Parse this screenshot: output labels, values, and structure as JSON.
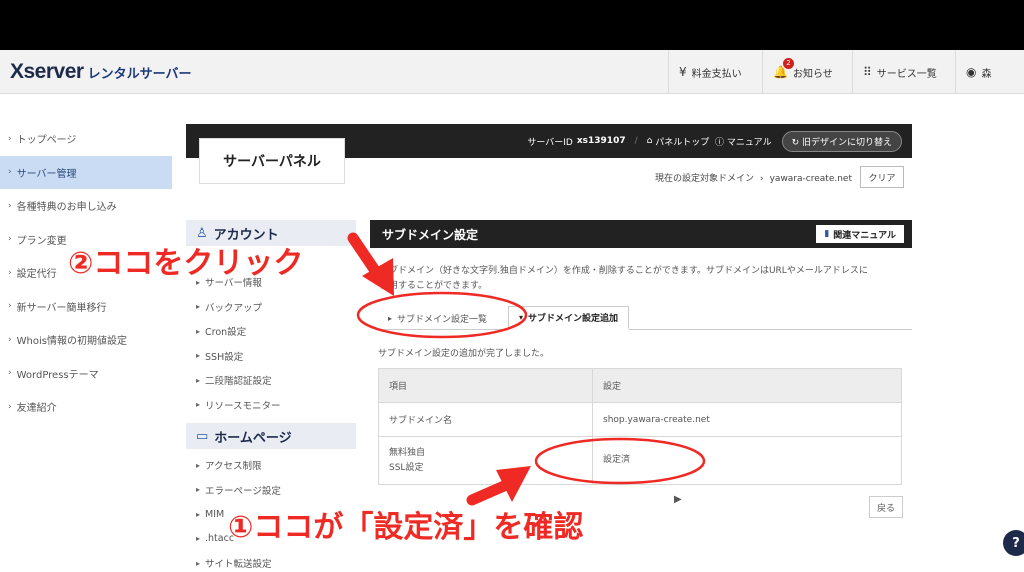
{
  "header": {
    "logo_main": "Xserver",
    "logo_sub": "レンタルサーバー",
    "nav": [
      {
        "icon": "yen-icon",
        "glyph": "¥",
        "label": "料金支払い"
      },
      {
        "icon": "bell-icon",
        "glyph": "🔔",
        "label": "お知らせ",
        "badge": "2"
      },
      {
        "icon": "grid-icon",
        "glyph": "⠿",
        "label": "サービス一覧"
      },
      {
        "icon": "user-icon",
        "glyph": "◉",
        "label": "森"
      }
    ]
  },
  "sidebar": {
    "items": [
      {
        "label": "トップページ"
      },
      {
        "label": "サーバー管理"
      },
      {
        "label": "各種特典のお申し込み"
      },
      {
        "label": "プラン変更"
      },
      {
        "label": "設定代行"
      },
      {
        "label": "新サーバー簡単移行"
      },
      {
        "label": "Whois情報の初期値設定"
      },
      {
        "label": "WordPressテーマ"
      },
      {
        "label": "友達紹介"
      }
    ]
  },
  "panel": {
    "title": "サーバーパネル",
    "server_id_label": "サーバーID",
    "server_id": "xs139107",
    "panel_top": "パネルトップ",
    "manual": "マニュアル",
    "old_design": "旧デザインに切り替え",
    "target_label": "現在の設定対象ドメイン",
    "target_domain": "yawara-create.net",
    "clear": "クリア"
  },
  "subnav": {
    "account": {
      "heading": "アカウント",
      "items": [
        "サーバー情報",
        "バックアップ",
        "Cron設定",
        "SSH設定",
        "二段階認証設定",
        "リソースモニター"
      ]
    },
    "homepage": {
      "heading": "ホームページ",
      "items": [
        "アクセス制限",
        "エラーページ設定",
        "MIM",
        ".htacc",
        "サイト転送設定"
      ]
    }
  },
  "main": {
    "title": "サブドメイン設定",
    "manual_btn": "関連マニュアル",
    "desc_line1": "サブドメイン（好きな文字列.独自ドメイン）を作成・削除することができます。サブドメインはURLやメールアドレスに",
    "desc_line2": "使用することができます。",
    "tabs": [
      "サブドメイン設定一覧",
      "サブドメイン設定追加"
    ],
    "complete_msg": "サブドメイン設定の追加が完了しました。",
    "table": {
      "headers": [
        "項目",
        "設定"
      ],
      "row1": [
        "サブドメイン名",
        "shop.yawara-create.net"
      ],
      "row2_label_1": "無料独自",
      "row2_label_2": "SSL設定",
      "row2_value": "設定済"
    },
    "back": "戻る"
  },
  "annotations": {
    "click_here": "②ココをクリック",
    "confirm": "①ココが「設定済」を確認"
  },
  "help": "?",
  "colors": {
    "annotation_red": "#ef2a24",
    "sidebar_active": "#c9dcf4",
    "dark_bar": "#222222"
  }
}
